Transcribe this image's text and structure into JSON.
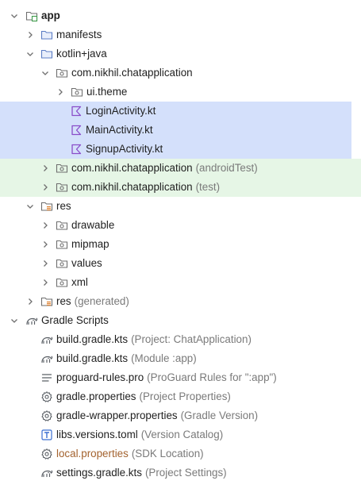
{
  "colors": {
    "selected_bg": "#d4e0fb",
    "test_bg": "#e6f6e6",
    "hint_text": "#7a7a7a",
    "local_properties_text": "#a3622e",
    "kotlin_icon": "#8a4dc9",
    "gradle_icon": "#5b6066"
  },
  "tree": {
    "app": {
      "label": "app",
      "icon": "module-folder-icon"
    },
    "manifests": {
      "label": "manifests",
      "icon": "folder-icon"
    },
    "kotlin_java": {
      "label": "kotlin+java",
      "icon": "folder-icon"
    },
    "pkg_main": {
      "label": "com.nikhil.chatapplication",
      "icon": "package-icon"
    },
    "ui_theme": {
      "label": "ui.theme",
      "icon": "package-icon"
    },
    "login_activity": {
      "label": "LoginActivity.kt",
      "icon": "kotlin-file-icon"
    },
    "main_activity": {
      "label": "MainActivity.kt",
      "icon": "kotlin-file-icon"
    },
    "signup_activity": {
      "label": "SignupActivity.kt",
      "icon": "kotlin-file-icon"
    },
    "pkg_android_test": {
      "label": "com.nikhil.chatapplication",
      "hint": "(androidTest)",
      "icon": "package-icon"
    },
    "pkg_test": {
      "label": "com.nikhil.chatapplication",
      "hint": "(test)",
      "icon": "package-icon"
    },
    "res": {
      "label": "res",
      "icon": "resource-folder-icon"
    },
    "drawable": {
      "label": "drawable",
      "icon": "package-icon"
    },
    "mipmap": {
      "label": "mipmap",
      "icon": "package-icon"
    },
    "values": {
      "label": "values",
      "icon": "package-icon"
    },
    "xml": {
      "label": "xml",
      "icon": "package-icon"
    },
    "res_generated": {
      "label": "res",
      "hint": "(generated)",
      "icon": "resource-folder-icon"
    },
    "gradle_scripts": {
      "label": "Gradle Scripts",
      "icon": "gradle-icon"
    },
    "build_project": {
      "label": "build.gradle.kts",
      "hint": "(Project: ChatApplication)",
      "icon": "gradle-icon"
    },
    "build_module": {
      "label": "build.gradle.kts",
      "hint": "(Module :app)",
      "icon": "gradle-icon"
    },
    "proguard": {
      "label": "proguard-rules.pro",
      "hint": "(ProGuard Rules for \":app\")",
      "icon": "text-lines-icon"
    },
    "gradle_properties": {
      "label": "gradle.properties",
      "hint": "(Project Properties)",
      "icon": "settings-gear-icon"
    },
    "gradle_wrapper": {
      "label": "gradle-wrapper.properties",
      "hint": "(Gradle Version)",
      "icon": "settings-gear-icon"
    },
    "libs_versions": {
      "label": "libs.versions.toml",
      "hint": "(Version Catalog)",
      "icon": "toml-file-icon"
    },
    "local_properties": {
      "label": "local.properties",
      "hint": "(SDK Location)",
      "icon": "settings-gear-icon"
    },
    "settings_gradle": {
      "label": "settings.gradle.kts",
      "hint": "(Project Settings)",
      "icon": "gradle-icon"
    }
  }
}
